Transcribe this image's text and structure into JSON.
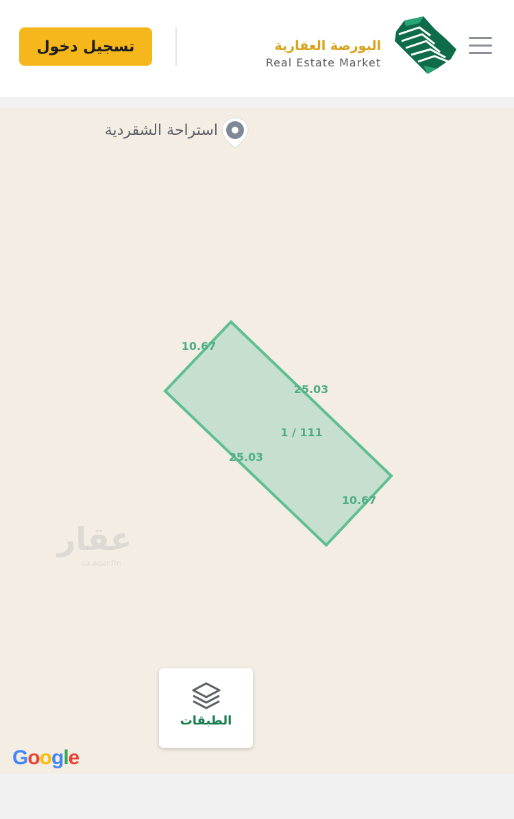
{
  "header": {
    "login_label": "تسجيل دخول",
    "brand_ar": "البورصة العقارية",
    "brand_en": "Real Estate Market",
    "logo_icon": "saudi-map-logo-icon",
    "menu_icon": "hamburger-menu-icon"
  },
  "map": {
    "poi_label": "استراحة الشقردية",
    "poi_icon": "map-pin-icon",
    "parcel": {
      "id_label": "1 / 111",
      "side_top_left": "10.67",
      "side_top_right": "25.03",
      "side_bottom_left": "25.03",
      "side_bottom_right": "10.67"
    },
    "watermark": "عقار",
    "watermark_sub": "sa.aqar.fm",
    "layers_label": "الطبقات",
    "layers_icon": "layers-icon",
    "google_logo": "Google"
  },
  "colors": {
    "accent": "#f6b71d",
    "brand_green": "#1a7d4f",
    "parcel_stroke": "#5fbf92",
    "parcel_fill": "#c7dfcf",
    "map_bg": "#f3ede4"
  }
}
